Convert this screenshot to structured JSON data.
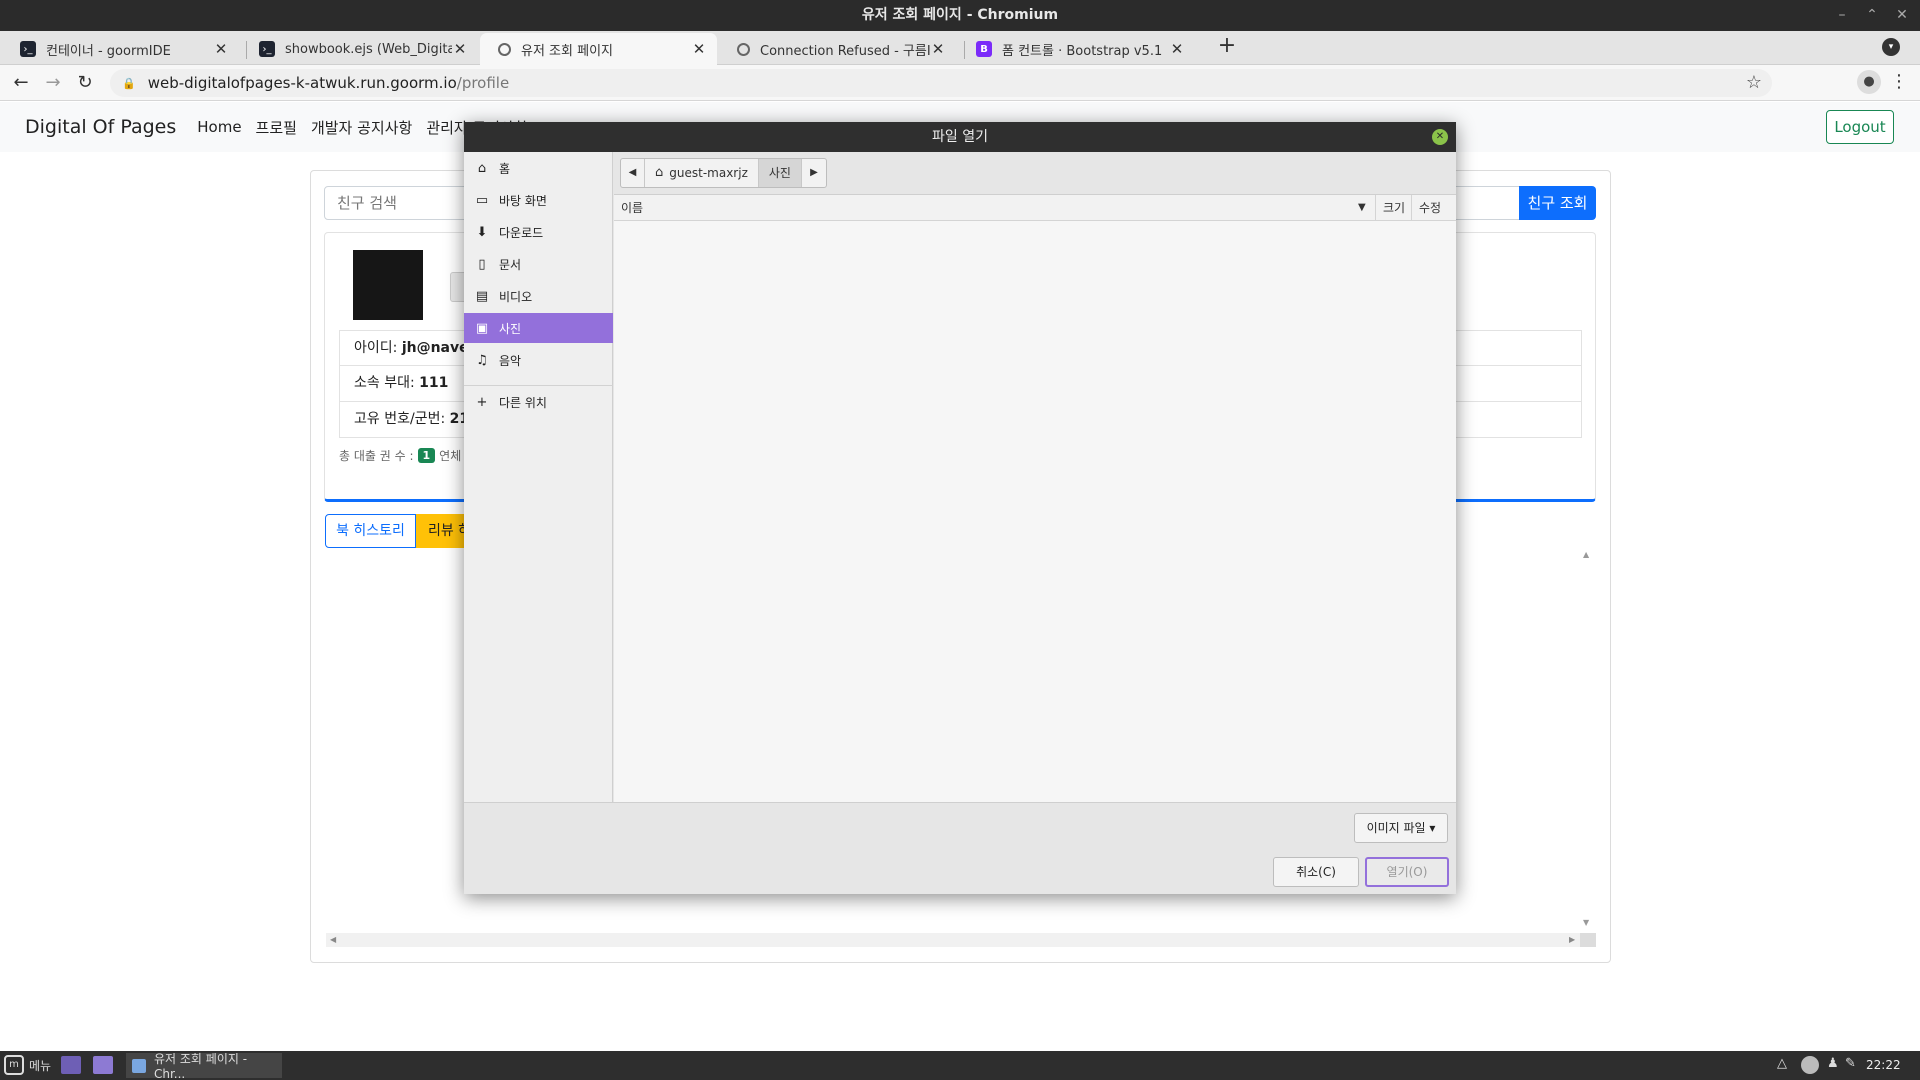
{
  "window": {
    "title": "유저 조회 페이지 - Chromium"
  },
  "tabs": [
    {
      "label": "컨테이너 - goormIDE",
      "icon": "terminal-icon"
    },
    {
      "label": "showbook.ejs (Web_DigitalOfP",
      "icon": "terminal-icon"
    },
    {
      "label": "유저 조회 페이지",
      "icon": "globe-icon"
    },
    {
      "label": "Connection Refused - 구름IDE",
      "icon": "globe-icon"
    },
    {
      "label": "폼 컨트롤 · Bootstrap v5.1",
      "icon": "bootstrap-icon",
      "favicon_letter": "B"
    }
  ],
  "address": {
    "host": "web-digitalofpages-k-atwuk.run.goorm.io",
    "path": "/profile"
  },
  "site": {
    "brand": "Digital Of Pages",
    "nav": [
      "Home",
      "프로필",
      "개발자 공지사항",
      "관리자 공지사항"
    ],
    "logout": "Logout"
  },
  "search": {
    "placeholder": "친구 검색",
    "button": "친구 조회"
  },
  "profile": {
    "fields": [
      {
        "label": "아이디: ",
        "value": "jh@naver"
      },
      {
        "label": "소속 부대: ",
        "value": "111"
      },
      {
        "label": "고유 번호/군번: ",
        "value": "21"
      }
    ],
    "loan_prefix": "총 대출 권 수 : ",
    "loan_count": "1",
    "loan_suffix": " 연체"
  },
  "buttons": {
    "history": "북 히스토리",
    "review": "리뷰 하"
  },
  "dialog": {
    "title": "파일 열기",
    "places": [
      {
        "label": "홈",
        "icon": "home-icon"
      },
      {
        "label": "바탕 화면",
        "icon": "desktop-icon"
      },
      {
        "label": "다운로드",
        "icon": "download-icon"
      },
      {
        "label": "문서",
        "icon": "document-icon"
      },
      {
        "label": "비디오",
        "icon": "video-icon"
      },
      {
        "label": "사진",
        "icon": "pictures-icon",
        "selected": true
      },
      {
        "label": "음악",
        "icon": "music-icon"
      },
      {
        "label": "다른 위치",
        "icon": "plus-icon"
      }
    ],
    "path": [
      "guest-maxrjz",
      "사진"
    ],
    "columns": {
      "name": "이름",
      "size": "크기",
      "modified": "수정"
    },
    "filter": "이미지 파일",
    "cancel": "취소(C)",
    "open": "열기(O)"
  },
  "taskbar": {
    "menu": "메뉴",
    "task": "유저 조회 페이지 - Chr...",
    "clock": "22:22"
  }
}
